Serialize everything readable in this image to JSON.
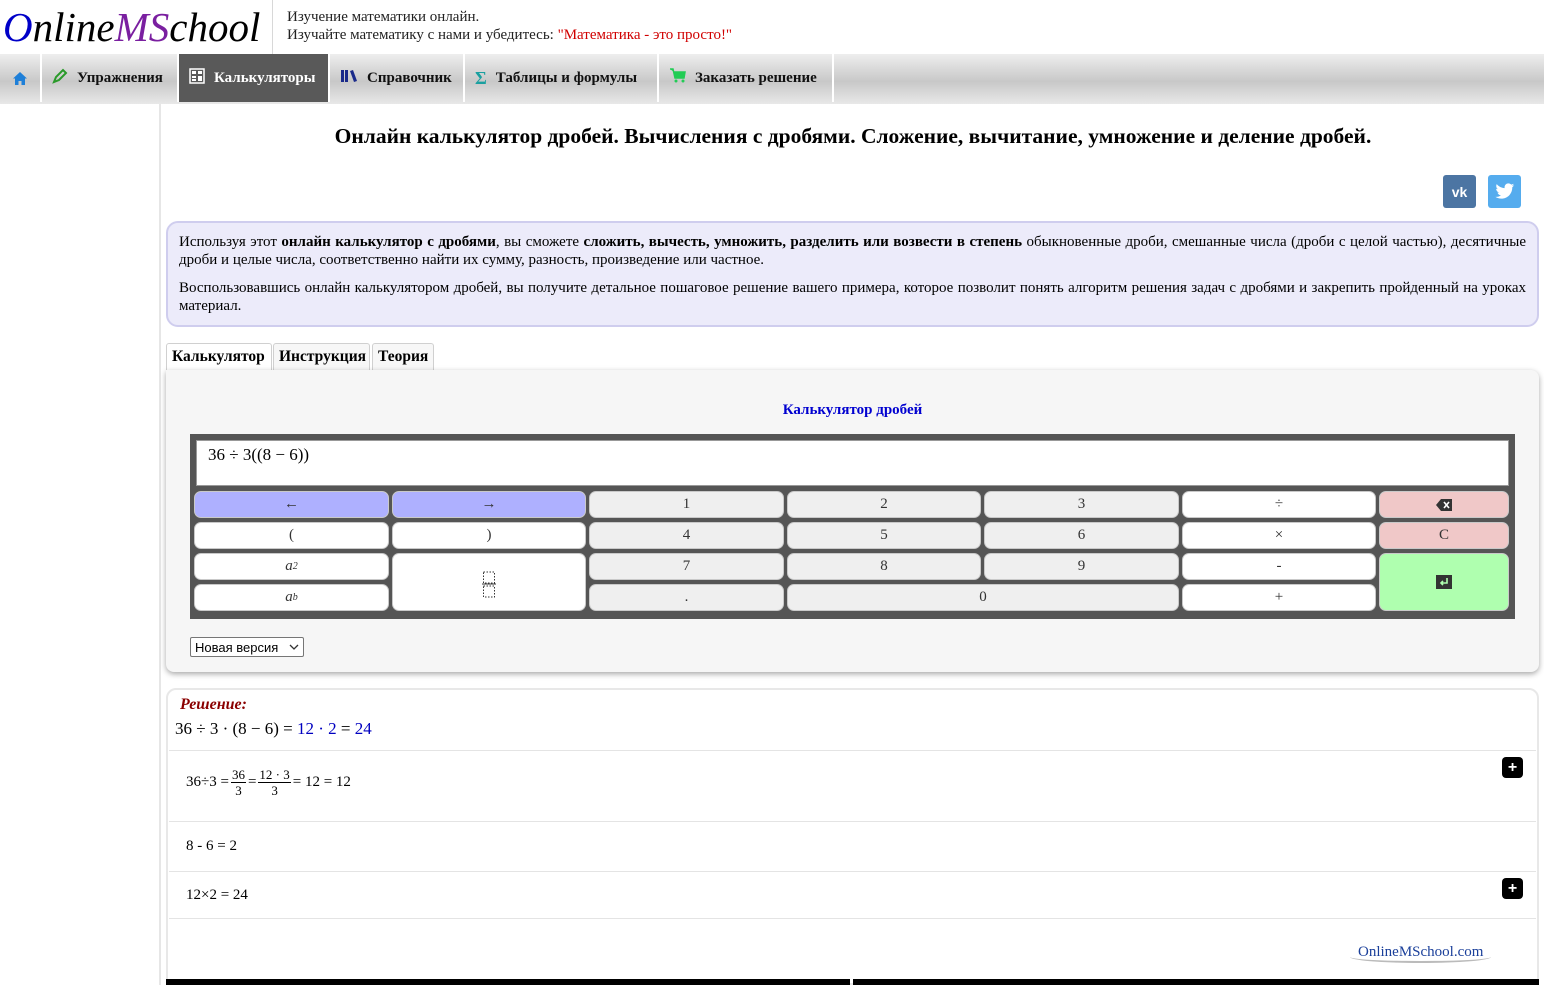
{
  "header": {
    "logo": {
      "part1": "O",
      "part2": "nline",
      "part3": "MS",
      "part4": "chool"
    },
    "tagline_line1": "Изучение математики онлайн.",
    "tagline_line2_prefix": "Изучайте математику с нами и убедитесь: ",
    "tagline_line2_quote": "\"Математика - это просто!\""
  },
  "nav": {
    "items": [
      {
        "label": "",
        "icon": "home-icon"
      },
      {
        "label": "Упражнения",
        "icon": "pencil-icon"
      },
      {
        "label": "Калькуляторы",
        "icon": "calculator-icon",
        "active": true
      },
      {
        "label": "Справочник",
        "icon": "books-icon"
      },
      {
        "label": "Таблицы и формулы",
        "icon": "sigma-icon"
      },
      {
        "label": "Заказать решение",
        "icon": "cart-icon"
      }
    ]
  },
  "page": {
    "title": "Онлайн калькулятор дробей. Вычисления с дробями. Сложение, вычитание, умножение и деление дробей."
  },
  "social": {
    "vk": "vk",
    "twitter": "twitter-icon"
  },
  "intro": {
    "p1_a": "Используя этот ",
    "p1_b": "онлайн калькулятор с дробями",
    "p1_c": ", вы сможете ",
    "p1_d": "сложить, вычесть, умножить, разделить или возвести в степень",
    "p1_e": " обыкновенные дроби, смешанные числа (дроби с целой частью), десятичные дроби и целые числа, соответственно найти их сумму, разность, произведение или частное.",
    "p2": "Воспользовавшись онлайн калькулятором дробей, вы получите детальное пошаговое решение вашего примера, которое позволит понять алгоритм решения задач с дробями и закрепить пройденный на уроках материал."
  },
  "tabs": [
    {
      "label": "Калькулятор",
      "active": true
    },
    {
      "label": "Инструкция"
    },
    {
      "label": "Теория"
    }
  ],
  "calculator": {
    "title": "Калькулятор дробей",
    "display": "36 ÷ 3((8 − 6))",
    "keys": {
      "left": "←",
      "right": "→",
      "k1": "1",
      "k2": "2",
      "k3": "3",
      "div": "÷",
      "backspace": "⌫",
      "lparen": "(",
      "rparen": ")",
      "k4": "4",
      "k5": "5",
      "k6": "6",
      "mul": "×",
      "clear": "C",
      "k7": "7",
      "k8": "8",
      "k9": "9",
      "minus": "-",
      "enter": "↵",
      "dot": ".",
      "k0": "0",
      "plus": "+",
      "square_base": "a",
      "square_exp": "2",
      "power_base": "a",
      "power_exp": "b"
    },
    "version_select": "Новая версия"
  },
  "solution": {
    "label": "Решение:",
    "line_main": "36 ÷ 3 · (8 − 6) = ",
    "line_mid": "12 · 2",
    "line_eq": " = ",
    "line_result": "24",
    "step1": {
      "prefix": "36÷3 = ",
      "f1_num": "36",
      "f1_den": "3",
      "eq1": " = ",
      "f2_num": "12 · 3",
      "f2_den": "3",
      "tail": " = 12 = 12"
    },
    "step2": "8 - 6 = 2",
    "step3": "12×2 = 24",
    "plus": "+",
    "footer_link": "OnlineMSchool.com"
  }
}
